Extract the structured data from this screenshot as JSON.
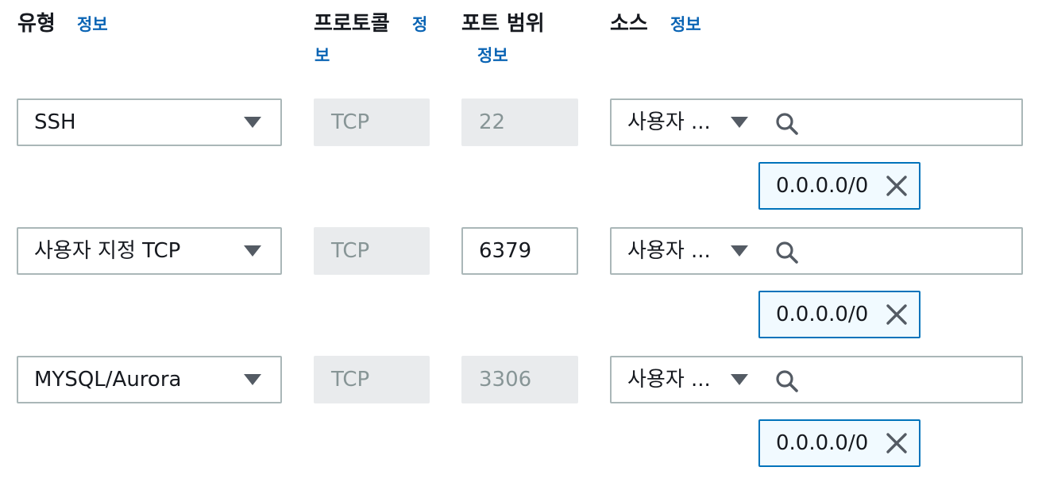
{
  "header": {
    "type_label": "유형",
    "type_info": "정보",
    "protocol_label": "프로토콜",
    "protocol_info_part1": "정",
    "protocol_info_part2": "보",
    "port_label": "포트 범위",
    "port_info": "정보",
    "source_label": "소스",
    "source_info": "정보"
  },
  "rules": [
    {
      "type": "SSH",
      "protocol": "TCP",
      "port": "22",
      "source_type": "사용자 ...",
      "search_placeholder": "",
      "token": "0.0.0.0/0"
    },
    {
      "type": "사용자 지정 TCP",
      "protocol": "TCP",
      "port": "6379",
      "source_type": "사용자 ...",
      "search_placeholder": "",
      "token": "0.0.0.0/0"
    },
    {
      "type": "MYSQL/Aurora",
      "protocol": "TCP",
      "port": "3306",
      "source_type": "사용자 ...",
      "search_placeholder": "",
      "token": "0.0.0.0/0"
    }
  ],
  "icons": {
    "dropdown": "caret-down-icon",
    "search": "search-icon",
    "remove": "close-icon"
  },
  "colors": {
    "link": "#0a64b4",
    "token_border": "#0073bb",
    "token_bg": "#f1faff",
    "disabled_bg": "#e9ebed",
    "border": "#aab7b8"
  }
}
